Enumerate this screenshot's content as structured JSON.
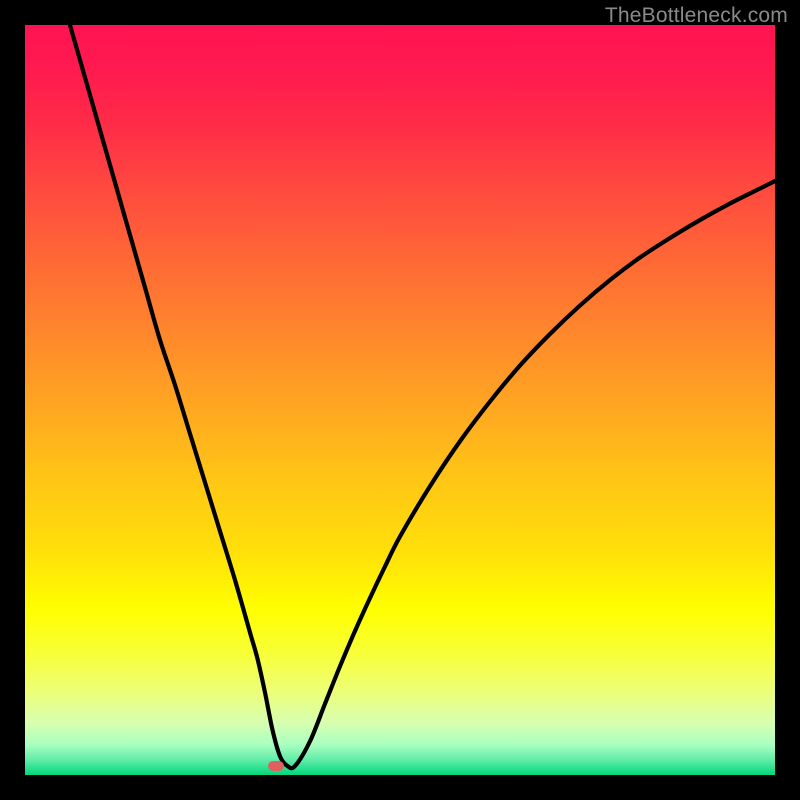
{
  "watermark": "TheBottleneck.com",
  "marker": {
    "x_pct": 33.5,
    "y_pct": 98.8
  },
  "chart_data": {
    "type": "line",
    "title": "",
    "xlabel": "",
    "ylabel": "",
    "xlim": [
      0,
      100
    ],
    "ylim": [
      0,
      100
    ],
    "x": [
      6,
      8,
      10,
      12,
      14,
      16,
      18,
      20,
      22,
      24,
      26,
      28,
      30,
      31,
      32,
      33,
      34,
      35,
      36,
      38,
      40,
      42,
      44,
      46,
      48,
      50,
      54,
      58,
      62,
      66,
      70,
      74,
      78,
      82,
      86,
      90,
      94,
      98,
      100
    ],
    "values": [
      100,
      93,
      86,
      79,
      72,
      65,
      58,
      52,
      45.5,
      39,
      32.5,
      26,
      19,
      15.5,
      11,
      6,
      2.5,
      1.2,
      1.2,
      4.5,
      9.5,
      14.5,
      19.2,
      23.6,
      27.8,
      31.8,
      38.5,
      44.5,
      49.8,
      54.6,
      58.8,
      62.6,
      66.0,
      69.0,
      71.6,
      74.0,
      76.2,
      78.2,
      79.2
    ],
    "annotations": [
      {
        "text": "TheBottleneck.com",
        "position": "top-right"
      }
    ],
    "background_gradient": {
      "orientation": "vertical",
      "stops": [
        {
          "pct": 0,
          "color": "#ff1452"
        },
        {
          "pct": 50,
          "color": "#ffaa20"
        },
        {
          "pct": 78,
          "color": "#ffff00"
        },
        {
          "pct": 100,
          "color": "#00d87a"
        }
      ]
    }
  }
}
